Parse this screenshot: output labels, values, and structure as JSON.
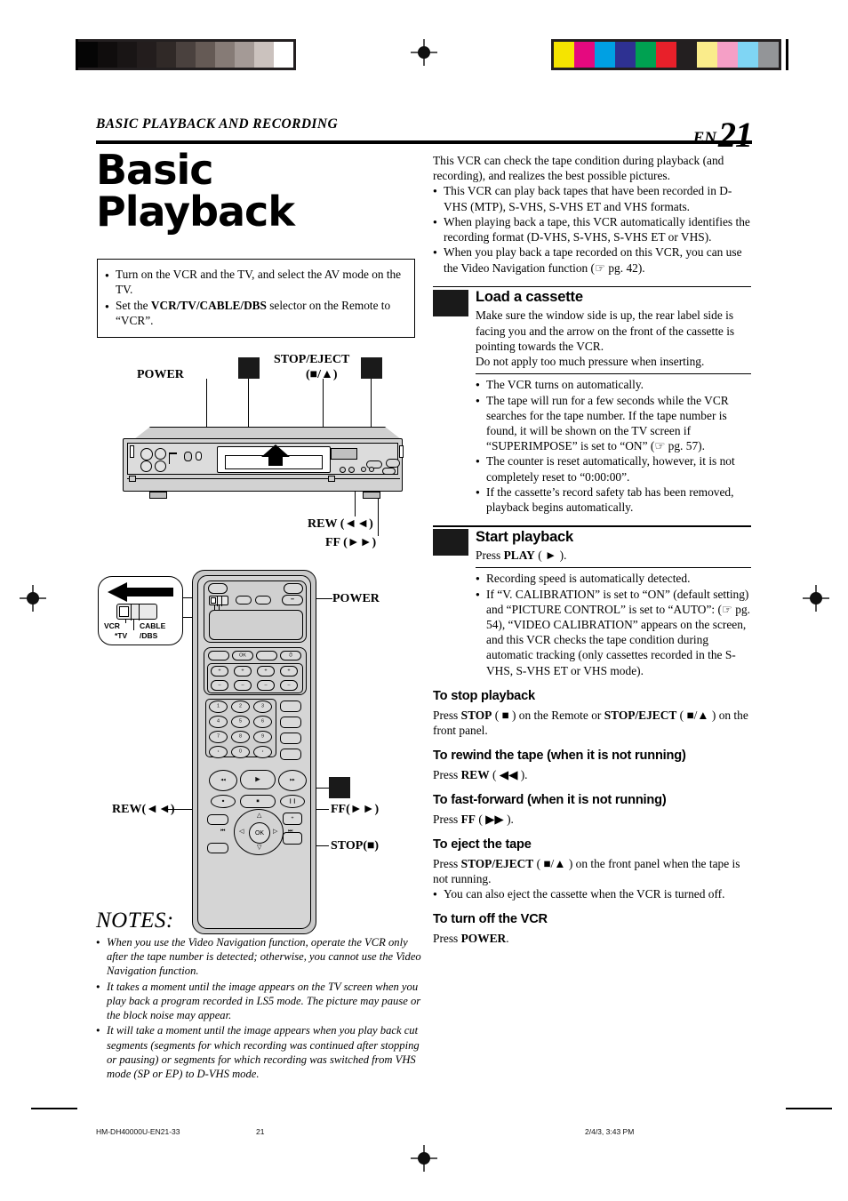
{
  "header": {
    "running_head": "BASIC PLAYBACK AND RECORDING",
    "en_label": "EN",
    "page_number": "21"
  },
  "left_column": {
    "title_line1": "Basic",
    "title_line2": "Playback",
    "prep_box": [
      "Turn on the VCR and the TV, and select the AV mode on the TV.",
      "Set the VCR/TV/CABLE/DBS selector on the Remote to “VCR”."
    ],
    "prep_box_bold_term": "VCR/TV/CABLE/DBS",
    "vcr_figure": {
      "labels": {
        "power": "POWER",
        "stop_eject_line1": "STOP/EJECT",
        "stop_eject_line2": "(■/▲)",
        "rew": "REW (◄◄)",
        "ff": "FF (►►)"
      }
    },
    "remote_figure": {
      "selector_labels": {
        "vcr": "VCR",
        "tv": "*TV",
        "cable_dbs": "CABLE\n/DBS",
        "cable": "CABLE",
        "dbs": "/DBS"
      },
      "labels": {
        "power": "POWER",
        "rew": "REW(◄◄)",
        "ff": "FF(►►)",
        "stop": "STOP(■)"
      },
      "keypad": [
        "1",
        "2",
        "3",
        "4",
        "5",
        "6",
        "7",
        "8",
        "9",
        "0"
      ],
      "ok_key": "OK"
    },
    "notes": {
      "heading": "NOTES:",
      "items": [
        "When you use the Video Navigation function, operate the VCR only after the tape number is detected; otherwise, you cannot use the Video Navigation function.",
        "It takes a moment until the image appears on the TV screen when you play back a program recorded in LS5 mode. The picture may pause or the block noise may appear.",
        "It will take a moment until the image appears when you play back cut segments (segments for which recording was continued after stopping or pausing) or segments for which recording was switched from VHS mode (SP or EP) to D-VHS mode."
      ]
    }
  },
  "right_column": {
    "intro_paragraph": "This VCR can check the tape condition during playback (and recording), and realizes the best possible pictures.",
    "intro_bullets": [
      "This VCR can play back tapes that have been recorded in D-VHS (MTP), S-VHS, S-VHS ET and VHS formats.",
      "When playing back a tape, this VCR automatically identifies the recording format (D-VHS, S-VHS, S-VHS ET or VHS).",
      "When you play back a tape recorded on this VCR, you can use the Video Navigation function (☞ pg. 42)."
    ],
    "step1": {
      "heading": "Load a cassette",
      "body": "Make sure the window side is up, the rear label side is facing you and the arrow on the front of the cassette is pointing towards the VCR.\nDo not apply too much pressure when inserting.",
      "body_line1": "Make sure the window side is up, the rear label side is facing you and the arrow on the front of the cassette is pointing towards the VCR.",
      "body_line2": "Do not apply too much pressure when inserting.",
      "bullets": [
        "The VCR turns on automatically.",
        "The tape will run for a few seconds while the VCR searches for the tape number. If the tape number is found, it will be shown on the TV screen if “SUPERIMPOSE” is set to “ON” (☞ pg. 57).",
        "The counter is reset automatically, however, it is not completely reset to “0:00:00”.",
        "If the cassette’s record safety tab has been removed, playback begins automatically."
      ]
    },
    "step2": {
      "heading": "Start playback",
      "body_prefix": "Press ",
      "body_bold": "PLAY",
      "body_suffix": " ( ► ).",
      "bullets": [
        "Recording speed is automatically detected.",
        "If “V. CALIBRATION” is set to “ON” (default setting) and “PICTURE CONTROL” is set to “AUTO”: (☞ pg. 54), “VIDEO CALIBRATION” appears on the screen, and this VCR checks the tape condition during automatic tracking (only cassettes recorded in the S-VHS, S-VHS ET or VHS mode)."
      ]
    },
    "subsections": [
      {
        "heading": "To stop playback",
        "body": "Press STOP ( ■ ) on the Remote or STOP/EJECT ( ■/▲ ) on the front panel."
      },
      {
        "heading": "To rewind the tape (when it is not running)",
        "body": "Press REW ( ◄◄ )."
      },
      {
        "heading": "To fast-forward (when it is not running)",
        "body": "Press FF ( ►► )."
      },
      {
        "heading": "To eject the tape",
        "body": "Press STOP/EJECT ( ■/▲ ) on the front panel when the tape is not running.",
        "bullet": "You can also eject the cassette when the VCR is turned off."
      },
      {
        "heading": "To turn off the VCR",
        "body": "Press POWER."
      }
    ]
  },
  "footer": {
    "document_id": "HM-DH40000U-EN21-33",
    "page": "21",
    "timestamp": "2/4/3, 3:43 PM"
  },
  "calibration": {
    "gray_swatches": [
      "#050505",
      "#100d0d",
      "#191515",
      "#231d1d",
      "#302927",
      "#4a413e",
      "#655a55",
      "#867b76",
      "#a49a96",
      "#cbc2be",
      "#ffffff"
    ],
    "color_swatches": [
      "#f5e400",
      "#e5097f",
      "#00a0e3",
      "#2e3192",
      "#00a151",
      "#e8202a",
      "#231f20",
      "#faec8b",
      "#f59fc6",
      "#7fd5f4",
      "#939598"
    ]
  }
}
